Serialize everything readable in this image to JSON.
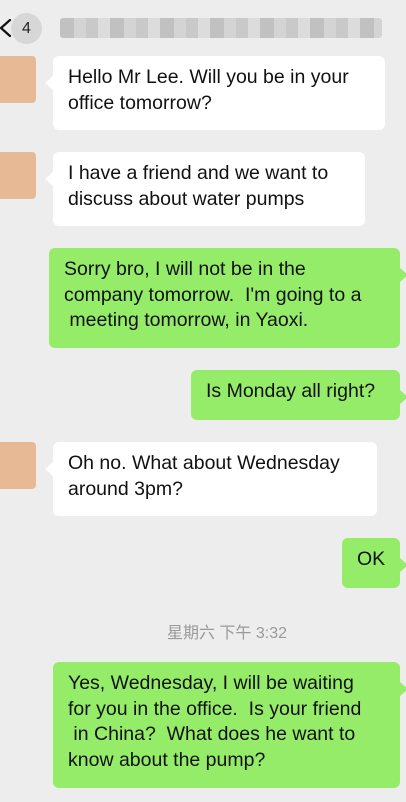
{
  "header": {
    "unread_count": "4",
    "contact_name": ""
  },
  "messages": [
    {
      "sender": "contact",
      "text": "Hello Mr Lee. Will you be in your\noffice tomorrow?"
    },
    {
      "sender": "contact",
      "text": "I have a friend and we want to\ndiscuss about water pumps"
    },
    {
      "sender": "me",
      "text": "Sorry bro, I will not be in the\ncompany tomorrow.  I'm going to a\n meeting tomorrow, in Yaoxi."
    },
    {
      "sender": "me",
      "text": "Is Monday all right?"
    },
    {
      "sender": "contact",
      "text": "Oh no. What about Wednesday\naround 3pm?"
    },
    {
      "sender": "me",
      "text": "OK"
    },
    {
      "sender": "me",
      "text": "Yes, Wednesday, I will be waiting\nfor you in the office.  Is your friend\n in China?  What does he want to\nknow about the pump?"
    }
  ],
  "timestamp": "星期六 下午 3:32",
  "colors": {
    "background": "#ededed",
    "incoming_bubble": "#ffffff",
    "outgoing_bubble": "#95ec69",
    "avatar": "#e7ba95"
  },
  "icons": {
    "back": "chevron-left-icon"
  }
}
